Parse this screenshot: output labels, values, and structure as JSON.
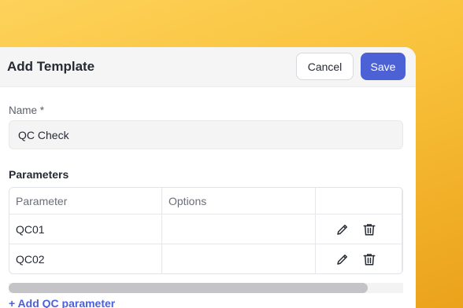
{
  "header": {
    "title": "Add Template",
    "cancel_label": "Cancel",
    "save_label": "Save"
  },
  "form": {
    "name_label": "Name *",
    "name_value": "QC Check",
    "parameters_heading": "Parameters",
    "table": {
      "columns": [
        "Parameter",
        "Options",
        ""
      ],
      "rows": [
        {
          "parameter": "QC01",
          "options": ""
        },
        {
          "parameter": "QC02",
          "options": ""
        }
      ]
    },
    "add_link": "+ Add QC parameter"
  },
  "icons": {
    "edit": "pencil-icon",
    "delete": "trash-icon"
  },
  "colors": {
    "accent": "#4c61d6",
    "background": "#f9c13a"
  }
}
